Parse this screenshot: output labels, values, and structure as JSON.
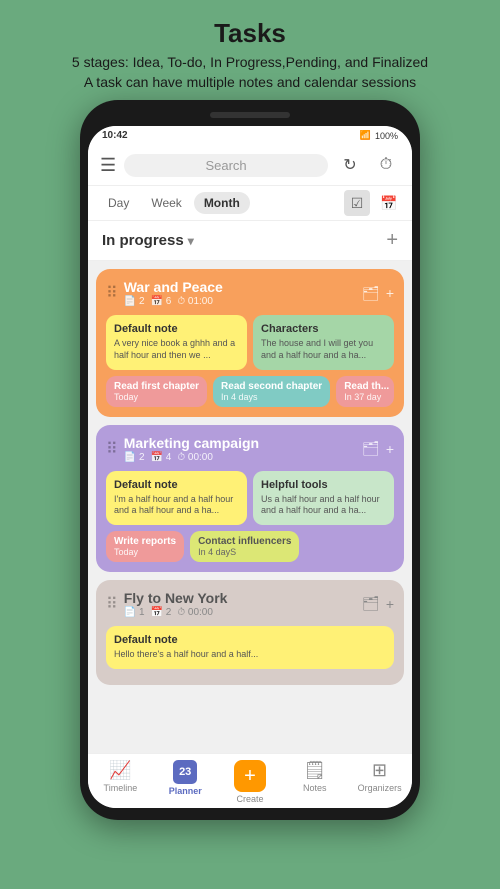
{
  "header": {
    "title": "Tasks",
    "subtitle_line1": "5 stages: Idea, To-do, In Progress,Pending, and Finalized",
    "subtitle_line2": "A task can have multiple notes and calendar sessions"
  },
  "status_bar": {
    "time": "10:42",
    "battery": "100%"
  },
  "top_bar": {
    "search_placeholder": "Search",
    "refresh_icon": "↻",
    "timer_icon": "⏱"
  },
  "tabs": {
    "day": "Day",
    "week": "Week",
    "month": "Month"
  },
  "section": {
    "title": "In progress",
    "add_icon": "+"
  },
  "tasks": [
    {
      "id": "war-and-peace",
      "title": "War and Peace",
      "meta": [
        "2",
        "6",
        "01:00"
      ],
      "color": "orange",
      "notes": [
        {
          "title": "Default note",
          "text": "A very nice book a ghhh and a half hour and then we ...",
          "color": "yellow"
        },
        {
          "title": "Characters",
          "text": "The house and I will get you and a half hour and a ha...",
          "color": "green"
        }
      ],
      "sessions": [
        {
          "title": "Read first chapter",
          "sub": "Today",
          "color": "salmon"
        },
        {
          "title": "Read second chapter",
          "sub": "In 4 days",
          "color": "teal"
        },
        {
          "title": "Read th...",
          "sub": "In 37 day",
          "color": "partial"
        }
      ]
    },
    {
      "id": "marketing-campaign",
      "title": "Marketing campaign",
      "meta": [
        "2",
        "4",
        "00:00"
      ],
      "color": "purple",
      "notes": [
        {
          "title": "Default note",
          "text": "I'm a half hour and a half hour and a half hour and a ha...",
          "color": "yellow"
        },
        {
          "title": "Helpful tools",
          "text": "Us a half hour and a half hour and a half hour and a ha...",
          "color": "light-green"
        }
      ],
      "sessions": [
        {
          "title": "Write reports",
          "sub": "Today",
          "color": "salmon"
        },
        {
          "title": "Contact influencers",
          "sub": "In 4 dayS",
          "color": "lime"
        }
      ]
    },
    {
      "id": "fly-to-new-york",
      "title": "Fly to New York",
      "meta": [
        "1",
        "2",
        "00:00"
      ],
      "color": "beige",
      "notes": [
        {
          "title": "Default note",
          "text": "Hello there's a half hour and a half...",
          "color": "yellow"
        }
      ],
      "sessions": []
    }
  ],
  "bottom_nav": [
    {
      "id": "timeline",
      "label": "Timeline",
      "icon": "📈"
    },
    {
      "id": "planner",
      "label": "Planner",
      "icon": "23",
      "active": true
    },
    {
      "id": "create",
      "label": "Create",
      "icon": "+"
    },
    {
      "id": "notes",
      "label": "Notes",
      "icon": "📝"
    },
    {
      "id": "organizers",
      "label": "Organizers",
      "icon": "⊞"
    }
  ]
}
